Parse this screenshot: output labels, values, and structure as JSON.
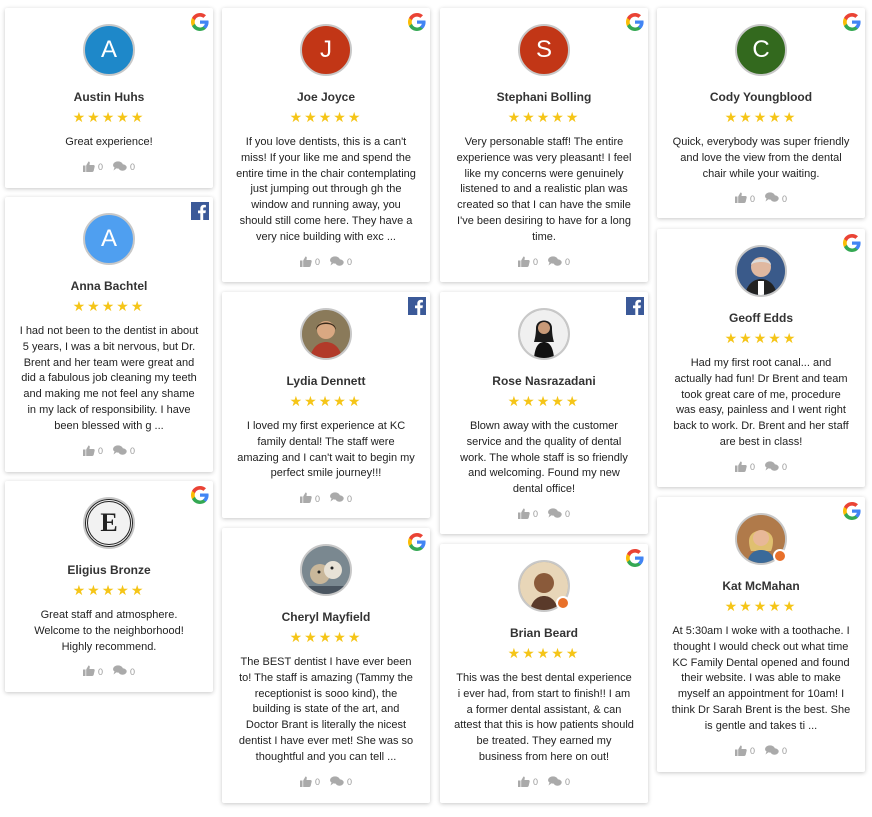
{
  "reviews": [
    {
      "name": "Austin Huhs",
      "initial": "A",
      "avatar_color": "#1e88c9",
      "source": "google",
      "stars": "★★★★★",
      "rating": 5,
      "text": "Great experience!",
      "likes": "0",
      "comments": "0"
    },
    {
      "name": "Anna Bachtel",
      "initial": "A",
      "avatar_color": "#4f9ff0",
      "source": "facebook",
      "stars": "★★★★★",
      "rating": 5,
      "text": "I had not been to the dentist in about 5 years, I was a bit nervous, but Dr. Brent and her team were great and did a fabulous job cleaning my teeth and making me not feel any shame in my lack of responsibility. I have been blessed with g ...",
      "likes": "0",
      "comments": "0"
    },
    {
      "name": "Eligius Bronze",
      "initial": "E",
      "avatar_color": "#222222",
      "source": "google",
      "stars": "★★★★★",
      "rating": 5,
      "text": "Great staff and atmosphere. Welcome to the neighborhood! Highly recommend.",
      "likes": "0",
      "comments": "0"
    },
    {
      "name": "Joe Joyce",
      "initial": "J",
      "avatar_color": "#c23616",
      "source": "google",
      "stars": "★★★★★",
      "rating": 5,
      "text": "If you love dentists, this is a can't miss! If your like me and spend the entire time in the chair contemplating just jumping out through gh the window and running away, you should still come here. They have a very nice building with exc ...",
      "likes": "0",
      "comments": "0"
    },
    {
      "name": "Lydia Dennett",
      "initial": "",
      "avatar_color": "#8a7a5a",
      "source": "facebook",
      "stars": "★★★★★",
      "rating": 5,
      "text": "I loved my first experience at KC family dental! The staff were amazing and I can't wait to begin my perfect smile journey!!!",
      "likes": "0",
      "comments": "0"
    },
    {
      "name": "Cheryl Mayfield",
      "initial": "",
      "avatar_color": "#6d7a80",
      "source": "google",
      "stars": "★★★★★",
      "rating": 5,
      "text": "The BEST dentist I have ever been to! The staff is amazing (Tammy the receptionist is sooo kind), the building is state of the art, and Doctor Brant is literally the nicest dentist I have ever met! She was so thoughtful and you can tell ...",
      "likes": "0",
      "comments": "0"
    },
    {
      "name": "Stephani Bolling",
      "initial": "S",
      "avatar_color": "#c23616",
      "source": "google",
      "stars": "★★★★★",
      "rating": 5,
      "text": "Very personable staff! The entire experience was very pleasant! I feel like my concerns were genuinely listened to and a realistic plan was created so that I can have the smile I've been desiring to have for a long time.",
      "likes": "0",
      "comments": "0"
    },
    {
      "name": "Rose Nasrazadani",
      "initial": "",
      "avatar_color": "#d8d8d8",
      "source": "facebook",
      "stars": "★★★★★",
      "rating": 5,
      "text": "Blown away with the customer service and the quality of dental work. The whole staff is so friendly and welcoming. Found my new dental office!",
      "likes": "0",
      "comments": "0"
    },
    {
      "name": "Brian Beard",
      "initial": "",
      "avatar_color": "#c2a27a",
      "source": "google",
      "stars": "★★★★★",
      "rating": 5,
      "text": "This was the best dental experience i ever had, from start to finish!! I am a former dental assistant, & can attest that this is how patients should be treated. They earned my business from here on out!",
      "likes": "0",
      "comments": "0"
    },
    {
      "name": "Cody Youngblood",
      "initial": "C",
      "avatar_color": "#33691e",
      "source": "google",
      "stars": "★★★★★",
      "rating": 5,
      "text": "Quick, everybody was super friendly and love the view from the dental chair while your waiting.",
      "likes": "0",
      "comments": "0"
    },
    {
      "name": "Geoff Edds",
      "initial": "",
      "avatar_color": "#3a5a8a",
      "source": "google",
      "stars": "★★★★★",
      "rating": 5,
      "text": "Had my first root canal... and actually had fun! Dr Brent and team took great care of me, procedure was easy, painless and I went right back to work. Dr. Brent and her staff are best in class!",
      "likes": "0",
      "comments": "0"
    },
    {
      "name": "Kat McMahan",
      "initial": "",
      "avatar_color": "#b07a4a",
      "source": "google",
      "stars": "★★★★★",
      "rating": 5,
      "text": "At 5:30am I woke with a toothache. I thought I would check out what time KC Family Dental opened and found their website. I was able to make myself an appointment for 10am! I think Dr Sarah Brent is the best. She is gentle and takes ti ...",
      "likes": "0",
      "comments": "0"
    }
  ]
}
